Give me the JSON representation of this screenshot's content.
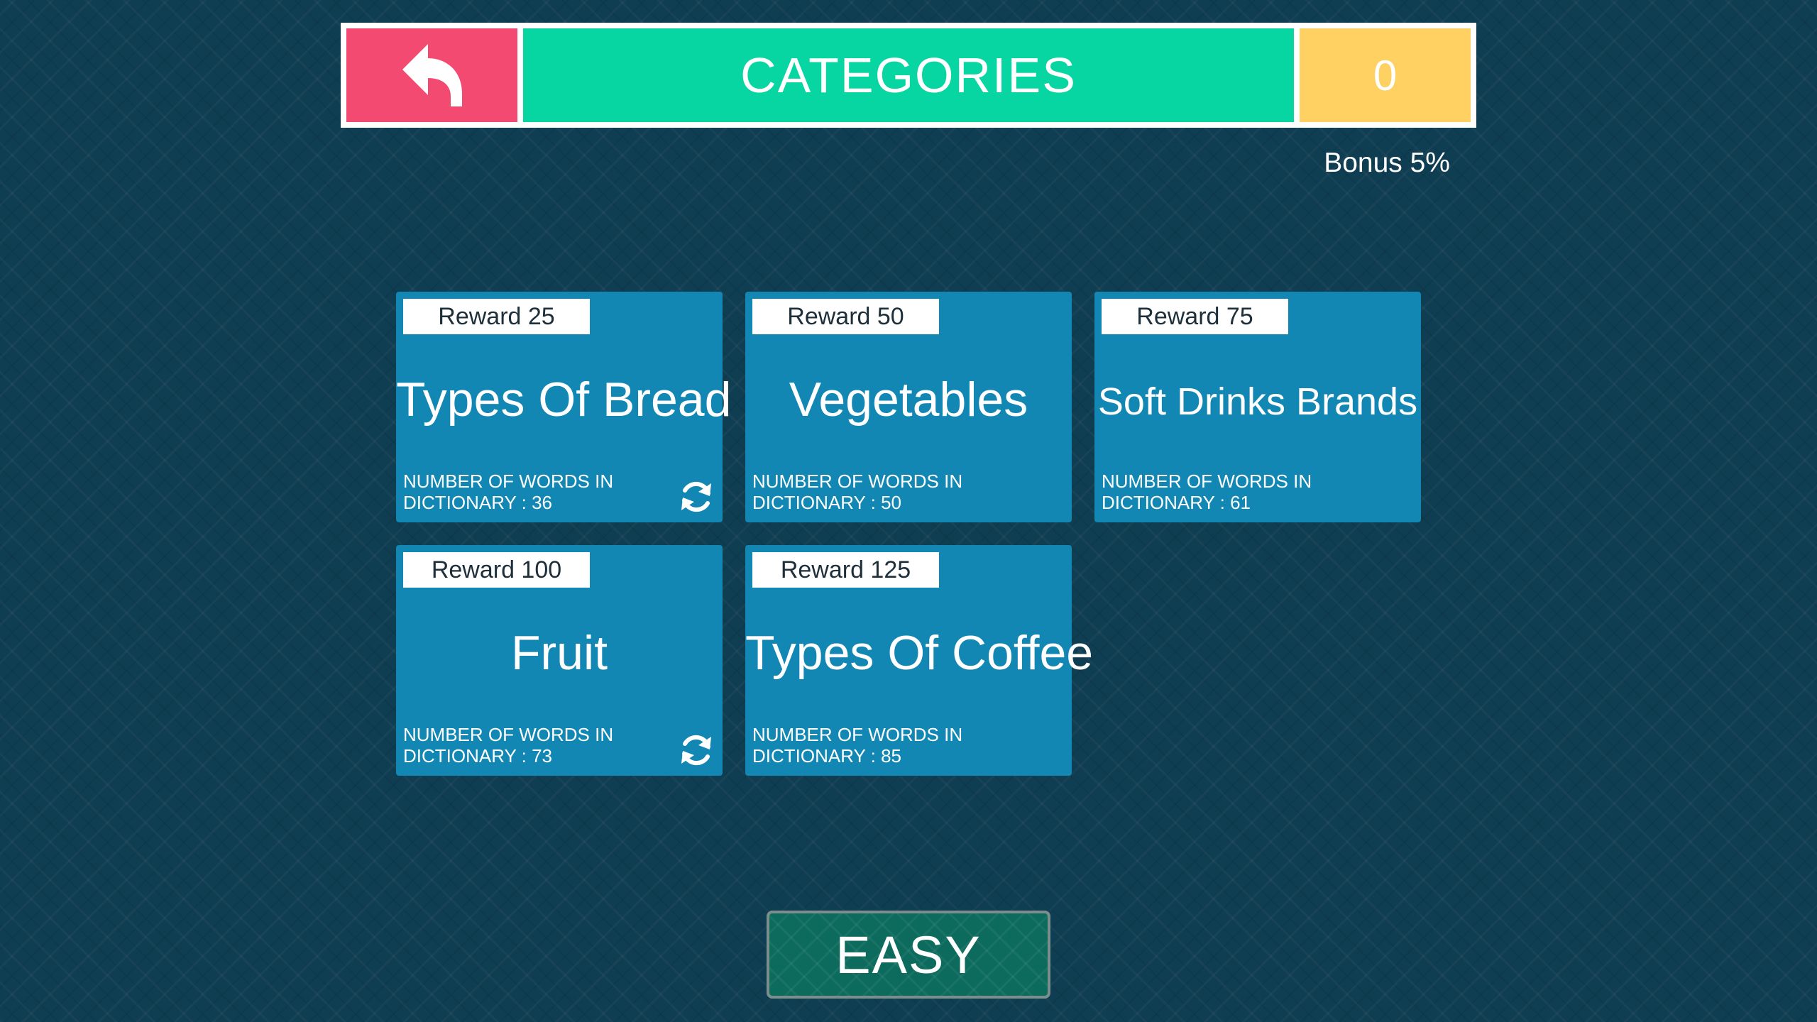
{
  "header": {
    "back_icon": "back-arrow-icon",
    "title": "CATEGORIES",
    "score": "0",
    "bonus": "Bonus 5%"
  },
  "colors": {
    "back": "#f34a72",
    "title": "#07d6a2",
    "score": "#ffd163",
    "card": "#1287b3",
    "difficulty": "#0d6b5e"
  },
  "categories": [
    {
      "reward": "Reward 25",
      "title": "Types Of Bread",
      "words_line1": "NUMBER OF WORDS IN",
      "words_line2": "DICTIONARY : 36",
      "refresh": true
    },
    {
      "reward": "Reward 50",
      "title": "Vegetables",
      "words_line1": "NUMBER OF WORDS IN",
      "words_line2": "DICTIONARY : 50",
      "refresh": false
    },
    {
      "reward": "Reward 75",
      "title": "Soft Drinks Brands",
      "words_line1": "NUMBER OF WORDS IN",
      "words_line2": "DICTIONARY : 61",
      "refresh": false
    },
    {
      "reward": "Reward 100",
      "title": "Fruit",
      "words_line1": "NUMBER OF WORDS IN",
      "words_line2": "DICTIONARY : 73",
      "refresh": true
    },
    {
      "reward": "Reward 125",
      "title": "Types Of Coffee",
      "words_line1": "NUMBER OF WORDS IN",
      "words_line2": "DICTIONARY : 85",
      "refresh": false
    }
  ],
  "difficulty": {
    "label": "EASY"
  }
}
